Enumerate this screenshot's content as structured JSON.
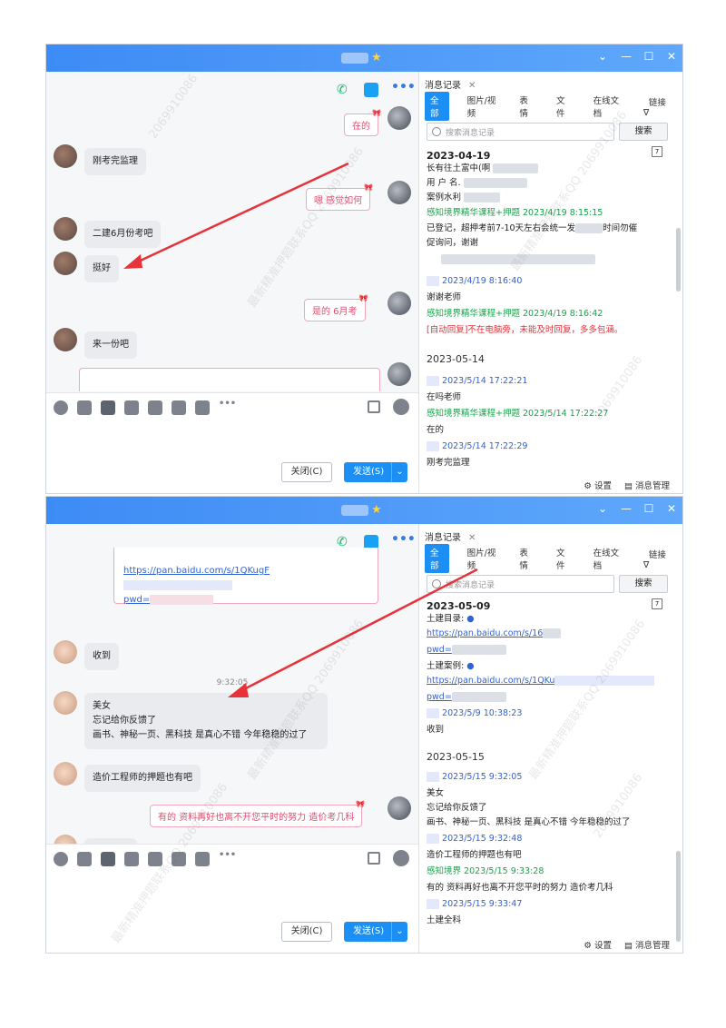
{
  "win1": {
    "history_tab": "消息记录",
    "categories": [
      "全部",
      "图片/视频",
      "表情",
      "文件",
      "在线文档",
      "链接"
    ],
    "search_placeholder": "搜索消息记录",
    "search_button": "搜索",
    "chat": [
      {
        "text": "在的",
        "side": "me"
      },
      {
        "text": "刚考完监理",
        "side": "other"
      },
      {
        "text": "嗯  感觉如何",
        "side": "me"
      },
      {
        "text": "二建6月份考吧",
        "side": "other"
      },
      {
        "text": "挺好",
        "side": "other"
      },
      {
        "text": "是的     6月考",
        "side": "me"
      },
      {
        "text": "来一份吧",
        "side": "other"
      }
    ],
    "records": [
      {
        "t": "2023-04-19",
        "type": "date"
      },
      {
        "t": "长有往土富中(啊",
        "type": "text"
      },
      {
        "t": "用  户  名.",
        "type": "text"
      },
      {
        "t": "案例水利",
        "type": "text"
      },
      {
        "t": "感知境界精华课程+押题 2023/4/19 8:15:15",
        "type": "green"
      },
      {
        "t": "已登记，超押考前7-10天左右会统一发",
        "type": "text"
      },
      {
        "t": "时间勿催",
        "type": "text2"
      },
      {
        "t": "促询问，谢谢",
        "type": "text"
      },
      {
        "t": "2023/4/19 8:16:40",
        "type": "blue"
      },
      {
        "t": "谢谢老师",
        "type": "text"
      },
      {
        "t": "感知境界精华课程+押题 2023/4/19 8:16:42",
        "type": "green"
      },
      {
        "t": "[自动回复]不在电脑旁，未能及时回复，多多包涵。",
        "type": "red"
      },
      {
        "t": "2023-05-14",
        "type": "date2"
      },
      {
        "t": "2023/5/14 17:22:21",
        "type": "blue"
      },
      {
        "t": "在吗老师",
        "type": "text"
      },
      {
        "t": "感知境界精华课程+押题 2023/5/14 17:22:27",
        "type": "green"
      },
      {
        "t": "在的",
        "type": "text"
      },
      {
        "t": "2023/5/14 17:22:29",
        "type": "blue"
      },
      {
        "t": "刚考完监理",
        "type": "text"
      }
    ],
    "close_label": "关闭(C)",
    "send_label": "发送(S)",
    "footer": {
      "settings": "设置",
      "manage": "消息管理"
    }
  },
  "win2": {
    "history_tab": "消息记录",
    "categories": [
      "全部",
      "图片/视频",
      "表情",
      "文件",
      "在线文档",
      "链接"
    ],
    "search_placeholder": "搜索消息记录",
    "search_button": "搜索",
    "link_card": {
      "link": "https://pan.baidu.com/s/1QKugF",
      "pwd": "pwd="
    },
    "chat": [
      {
        "text": "收到",
        "side": "other"
      },
      {
        "text": "9:32:05",
        "side": "time"
      },
      {
        "text": "美女",
        "side": "other"
      },
      {
        "text": "忘记给你反馈了",
        "side": "other"
      },
      {
        "text": "画书、神秘一页、黑科技 是真心不错  今年稳稳的过了",
        "side": "other"
      },
      {
        "text": "造价工程师的押题也有吧",
        "side": "other"
      },
      {
        "text": "有的   资料再好也离不开您平时的努力   造价考几科",
        "side": "me"
      },
      {
        "text": "土建全科",
        "side": "other"
      }
    ],
    "records": [
      {
        "t": "2023-05-09",
        "type": "date"
      },
      {
        "t": "土建目录:",
        "type": "text"
      },
      {
        "t": "https://pan.baidu.com/s/16",
        "type": "link"
      },
      {
        "t": "pwd=",
        "type": "link"
      },
      {
        "t": "土建案例:",
        "type": "text"
      },
      {
        "t": "https://pan.baidu.com/s/1QKu",
        "type": "link"
      },
      {
        "t": "pwd=",
        "type": "link"
      },
      {
        "t": "2023/5/9 10:38:23",
        "type": "blue"
      },
      {
        "t": "收到",
        "type": "text"
      },
      {
        "t": "2023-05-15",
        "type": "date2"
      },
      {
        "t": "2023/5/15 9:32:05",
        "type": "blue"
      },
      {
        "t": "美女",
        "type": "text"
      },
      {
        "t": "忘记给你反馈了",
        "type": "text"
      },
      {
        "t": "画书、神秘一页、黑科技 是真心不错  今年稳稳的过了",
        "type": "text"
      },
      {
        "t": "2023/5/15 9:32:48",
        "type": "blue"
      },
      {
        "t": "造价工程师的押题也有吧",
        "type": "text"
      },
      {
        "t": "感知境界 2023/5/15 9:33:28",
        "type": "green"
      },
      {
        "t": "有的  资料再好也离不开您平时的努力  造价考几科",
        "type": "text"
      },
      {
        "t": "2023/5/15 9:33:47",
        "type": "blue"
      },
      {
        "t": "土建全科",
        "type": "text"
      }
    ],
    "close_label": "关闭(C)",
    "send_label": "发送(S)",
    "footer": {
      "settings": "设置",
      "manage": "消息管理"
    }
  },
  "watermark": "最新精准押题联系QQ 2069910086",
  "watermark_num": "2069910086"
}
